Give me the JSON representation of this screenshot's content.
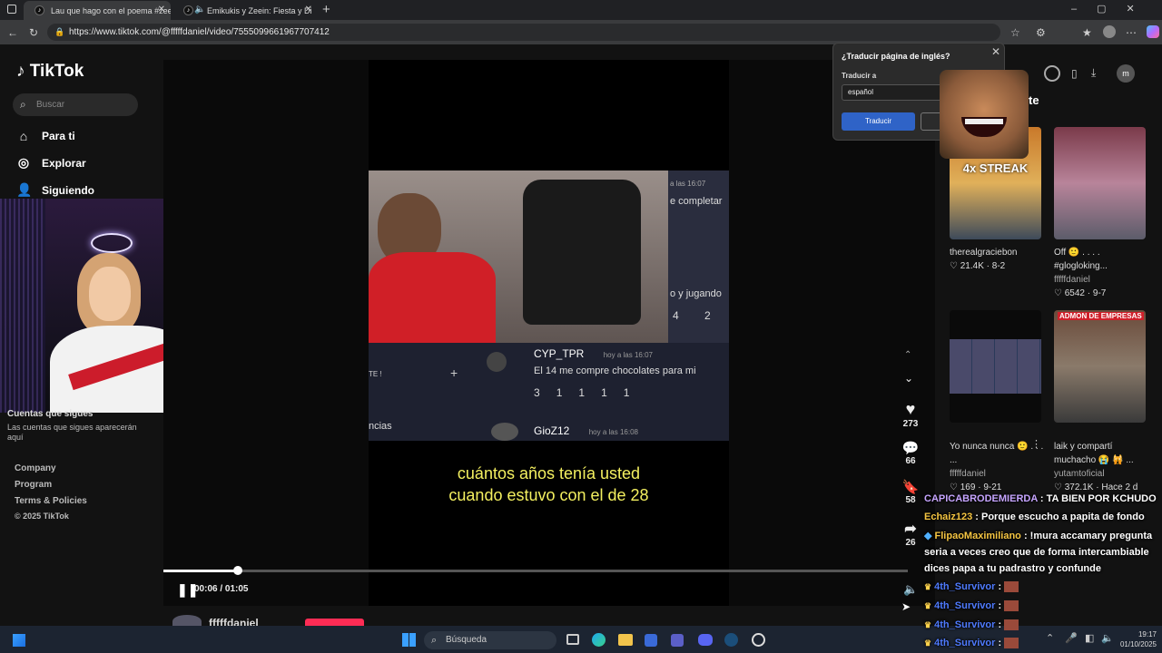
{
  "browser": {
    "tabs": [
      {
        "label": "Lau que hago con el poema #zee"
      },
      {
        "label": "Emikukis y Zeein: Fiesta y Di"
      }
    ],
    "url": "https://www.tiktok.com/@fffffdaniel/video/7555099661967707412"
  },
  "sidebar": {
    "logo": "TikTok",
    "search_placeholder": "Buscar",
    "nav": [
      {
        "label": "Para ti",
        "icon": "home-icon"
      },
      {
        "label": "Explorar",
        "icon": "compass-icon"
      },
      {
        "label": "Siguiendo",
        "icon": "following-icon"
      }
    ],
    "following_title": "Cuentas que sigues",
    "following_text": "Las cuentas que sigues aparecerán aquí",
    "footer": [
      "Company",
      "Program",
      "Terms & Policies",
      "© 2025 TikTok"
    ]
  },
  "video": {
    "caption_line1": "cuántos años tenía usted",
    "caption_line2": "cuando estuvo con el de 28",
    "time": "00:06 / 01:05",
    "progress": 0.1,
    "author": "fffffdaniel",
    "inner_chat": [
      {
        "user": "CYP_TPR",
        "time": "hoy a las 16:07",
        "text": "El 14 me compre chocolates para mi",
        "badges": [
          "3",
          "1",
          "1",
          "1",
          "1"
        ]
      },
      {
        "user": "GioZ12",
        "time": "hoy a las 16:08",
        "text": ""
      }
    ],
    "inner_side": [
      "a las 16:07",
      "e completar",
      "o y jugando",
      "4",
      "2"
    ],
    "inner_left": [
      "TE !",
      "ncias"
    ]
  },
  "actions": {
    "likes": "273",
    "comments": "66",
    "saves": "58",
    "shares": "26"
  },
  "right_panel": {
    "partial_title": "rte",
    "videos": [
      {
        "title": "therealgraciebon",
        "likes": "21.4K",
        "date": "8-2",
        "overlay": "4x STREAK"
      },
      {
        "title": "Off 🙂 . . . . #glogloking...",
        "author": "fffffdaniel",
        "likes": "6542",
        "date": "9-7"
      },
      {
        "title": "Yo nunca nunca 🙂 . . . ...",
        "author": "fffffdaniel",
        "likes": "169",
        "date": "9-21"
      },
      {
        "title": "laik y compartí muchacho 😭 🙀 ...",
        "author": "yutamtoficial",
        "likes": "372.1K",
        "date": "Hace 2 d",
        "overlay": "ADMON DE EMPRESAS"
      }
    ]
  },
  "translate": {
    "title": "¿Traducir página de inglés?",
    "label": "Traducir a",
    "language": "español",
    "button": "Traducir"
  },
  "stream_chat": [
    {
      "user": "CAPICABRODEMIERDA",
      "text": "TA BIEN POR KCHUDO",
      "color": "#c6a5ff"
    },
    {
      "user": "Echaiz123",
      "text": "Porque escucho a papita de fondo",
      "color": "#f5c542"
    },
    {
      "user": "FlipaoMaximiliano",
      "text": "!mura accamary pregunta seria a veces creo que de forma intercambiable dices papa a tu padrastro y confunde",
      "color": "#f5c542"
    },
    {
      "user": "4th_Survivor",
      "text": "",
      "color": "#4f7bff"
    },
    {
      "user": "4th_Survivor",
      "text": "",
      "color": "#4f7bff"
    },
    {
      "user": "4th_Survivor",
      "text": "",
      "color": "#4f7bff"
    },
    {
      "user": "4th_Survivor",
      "text": "",
      "color": "#4f7bff"
    }
  ],
  "taskbar": {
    "search_placeholder": "Búsqueda",
    "time": "19:17",
    "date": "01/10/2025"
  }
}
